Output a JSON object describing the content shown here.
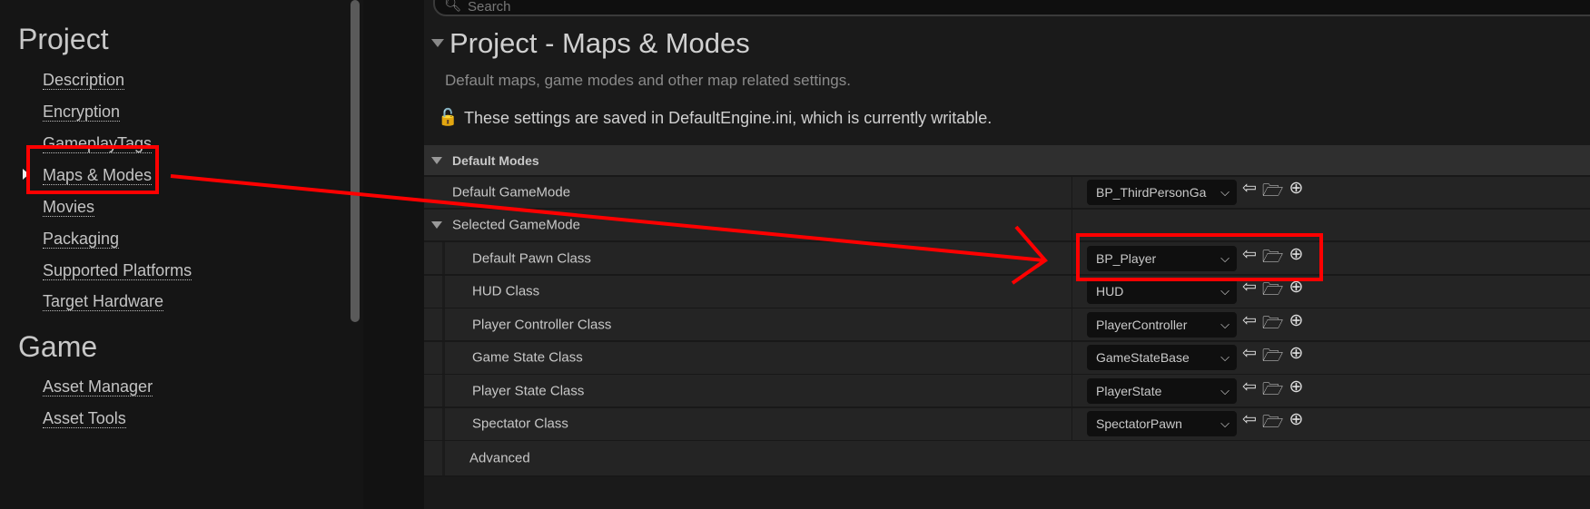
{
  "sidebar": {
    "categories": [
      {
        "label": "Project",
        "items": [
          "Description",
          "Encryption",
          "GameplayTags",
          "Maps & Modes",
          "Movies",
          "Packaging",
          "Supported Platforms",
          "Target Hardware"
        ]
      },
      {
        "label": "Game",
        "items": [
          "Asset Manager",
          "Asset Tools"
        ]
      }
    ],
    "selected": "Maps & Modes"
  },
  "main": {
    "search_placeholder": "Search",
    "title": "Project - Maps & Modes",
    "description": "Default maps, game modes and other map related settings.",
    "notice": "These settings are saved in DefaultEngine.ini, which is currently writable.",
    "section": "Default Modes",
    "default_gamemode": {
      "label": "Default GameMode",
      "value": "BP_ThirdPersonGa"
    },
    "selected_gamemode": "Selected GameMode",
    "rows": [
      {
        "label": "Default Pawn Class",
        "value": "BP_Player"
      },
      {
        "label": "HUD Class",
        "value": "HUD"
      },
      {
        "label": "Player Controller Class",
        "value": "PlayerController"
      },
      {
        "label": "Game State Class",
        "value": "GameStateBase"
      },
      {
        "label": "Player State Class",
        "value": "PlayerState"
      },
      {
        "label": "Spectator Class",
        "value": "SpectatorPawn"
      }
    ],
    "advanced": "Advanced"
  },
  "annotation_color": "#ff0000"
}
